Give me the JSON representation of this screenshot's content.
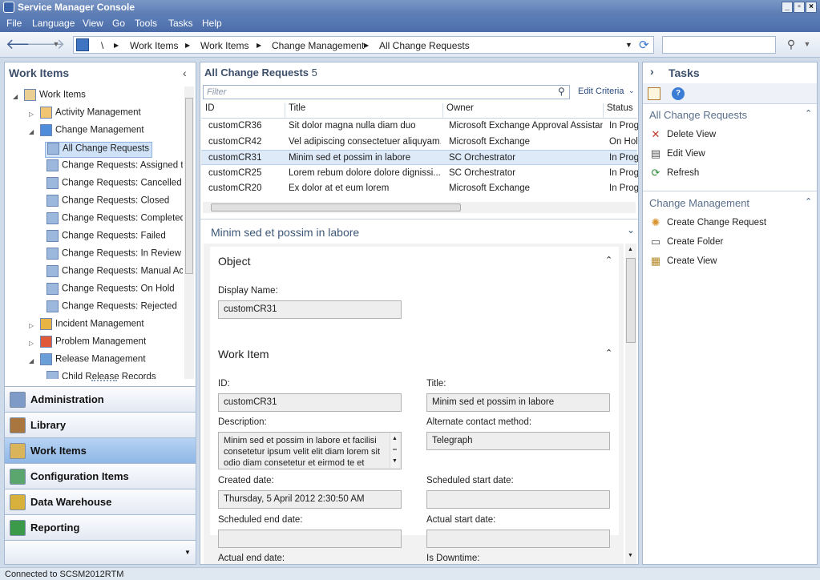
{
  "window": {
    "title": "Service Manager Console"
  },
  "menu": [
    "File",
    "Language",
    "View",
    "Go",
    "Tools",
    "Tasks",
    "Help"
  ],
  "breadcrumb": {
    "root": "\\",
    "items": [
      "Work Items",
      "Work Items",
      "Change Management",
      "All Change Requests"
    ]
  },
  "left": {
    "title": "Work Items",
    "tree": [
      {
        "label": "Work Items",
        "indent": 0,
        "expanded": true,
        "type": "folder"
      },
      {
        "label": "Activity Management",
        "indent": 1,
        "expanded": false,
        "type": "activity"
      },
      {
        "label": "Change Management",
        "indent": 1,
        "expanded": true,
        "type": "change"
      },
      {
        "label": "All Change Requests",
        "indent": 2,
        "selected": true,
        "type": "view"
      },
      {
        "label": "Change Requests: Assigned to N",
        "indent": 2,
        "type": "view"
      },
      {
        "label": "Change Requests: Cancelled",
        "indent": 2,
        "type": "view"
      },
      {
        "label": "Change Requests: Closed",
        "indent": 2,
        "type": "view"
      },
      {
        "label": "Change Requests: Completed",
        "indent": 2,
        "type": "view"
      },
      {
        "label": "Change Requests: Failed",
        "indent": 2,
        "type": "view"
      },
      {
        "label": "Change Requests: In Review",
        "indent": 2,
        "type": "view"
      },
      {
        "label": "Change Requests: Manual Activi",
        "indent": 2,
        "type": "view"
      },
      {
        "label": "Change Requests: On Hold",
        "indent": 2,
        "type": "view"
      },
      {
        "label": "Change Requests: Rejected",
        "indent": 2,
        "type": "view"
      },
      {
        "label": "Incident Management",
        "indent": 1,
        "expanded": false,
        "type": "incident"
      },
      {
        "label": "Problem Management",
        "indent": 1,
        "expanded": false,
        "type": "problem"
      },
      {
        "label": "Release Management",
        "indent": 1,
        "expanded": true,
        "type": "release"
      },
      {
        "label": "Child Release Records",
        "indent": 2,
        "type": "view"
      }
    ],
    "wunderbar": [
      {
        "label": "Administration",
        "color": "#7d9bc6"
      },
      {
        "label": "Library",
        "color": "#a9763f"
      },
      {
        "label": "Work Items",
        "color": "#d9b45a",
        "active": true
      },
      {
        "label": "Configuration Items",
        "color": "#5aa66e"
      },
      {
        "label": "Data Warehouse",
        "color": "#d8b13c"
      },
      {
        "label": "Reporting",
        "color": "#3b9a4a"
      }
    ]
  },
  "grid": {
    "title": "All Change Requests",
    "count": "5",
    "filter_placeholder": "Filter",
    "edit_criteria": "Edit Criteria",
    "columns": [
      "ID",
      "Title",
      "Owner",
      "Status"
    ],
    "rows": [
      [
        "customCR36",
        "Sit dolor magna nulla diam duo",
        "Microsoft Exchange Approval Assistant",
        "In Prog"
      ],
      [
        "customCR42",
        "Vel adipiscing consectetuer aliquyam...",
        "Microsoft Exchange",
        "On Hold"
      ],
      [
        "customCR31",
        "Minim sed et possim in labore",
        "SC Orchestrator",
        "In Prog"
      ],
      [
        "customCR25",
        "Lorem rebum dolore dolore dignissi...",
        "SC Orchestrator",
        "In Prog"
      ],
      [
        "customCR20",
        "Ex dolor at et eum lorem",
        "Microsoft Exchange",
        "In Prog"
      ]
    ],
    "selected_row": 2
  },
  "details": {
    "title": "Minim sed et possim in labore",
    "object_section": "Object",
    "display_name_label": "Display Name:",
    "display_name": "customCR31",
    "work_item_section": "Work Item",
    "id_label": "ID:",
    "id": "customCR31",
    "title_label": "Title:",
    "description_label": "Description:",
    "description": "Minim sed et possim in labore et facilisi consetetur ipsum velit elit diam lorem sit odio diam consetetur et eirmod te et",
    "alt_contact_label": "Alternate contact method:",
    "alt_contact": "Telegraph",
    "created_label": "Created date:",
    "created": "Thursday, 5 April 2012 2:30:50 AM",
    "sched_start_label": "Scheduled start date:",
    "sched_start": "",
    "sched_end_label": "Scheduled end date:",
    "sched_end": "",
    "actual_start_label": "Actual start date:",
    "actual_start": "",
    "actual_end_label": "Actual end date:",
    "downtime_label": "Is Downtime:"
  },
  "tasks": {
    "title": "Tasks",
    "groups": [
      {
        "title": "All Change Requests",
        "items": [
          {
            "label": "Delete View",
            "icon": "delete-icon"
          },
          {
            "label": "Edit View",
            "icon": "edit-view-icon"
          },
          {
            "label": "Refresh",
            "icon": "refresh-icon"
          }
        ]
      },
      {
        "title": "Change Management",
        "items": [
          {
            "label": "Create Change Request",
            "icon": "create-change-icon"
          },
          {
            "label": "Create Folder",
            "icon": "folder-icon"
          },
          {
            "label": "Create View",
            "icon": "create-view-icon"
          }
        ]
      }
    ]
  },
  "status": "Connected to SCSM2012RTM"
}
